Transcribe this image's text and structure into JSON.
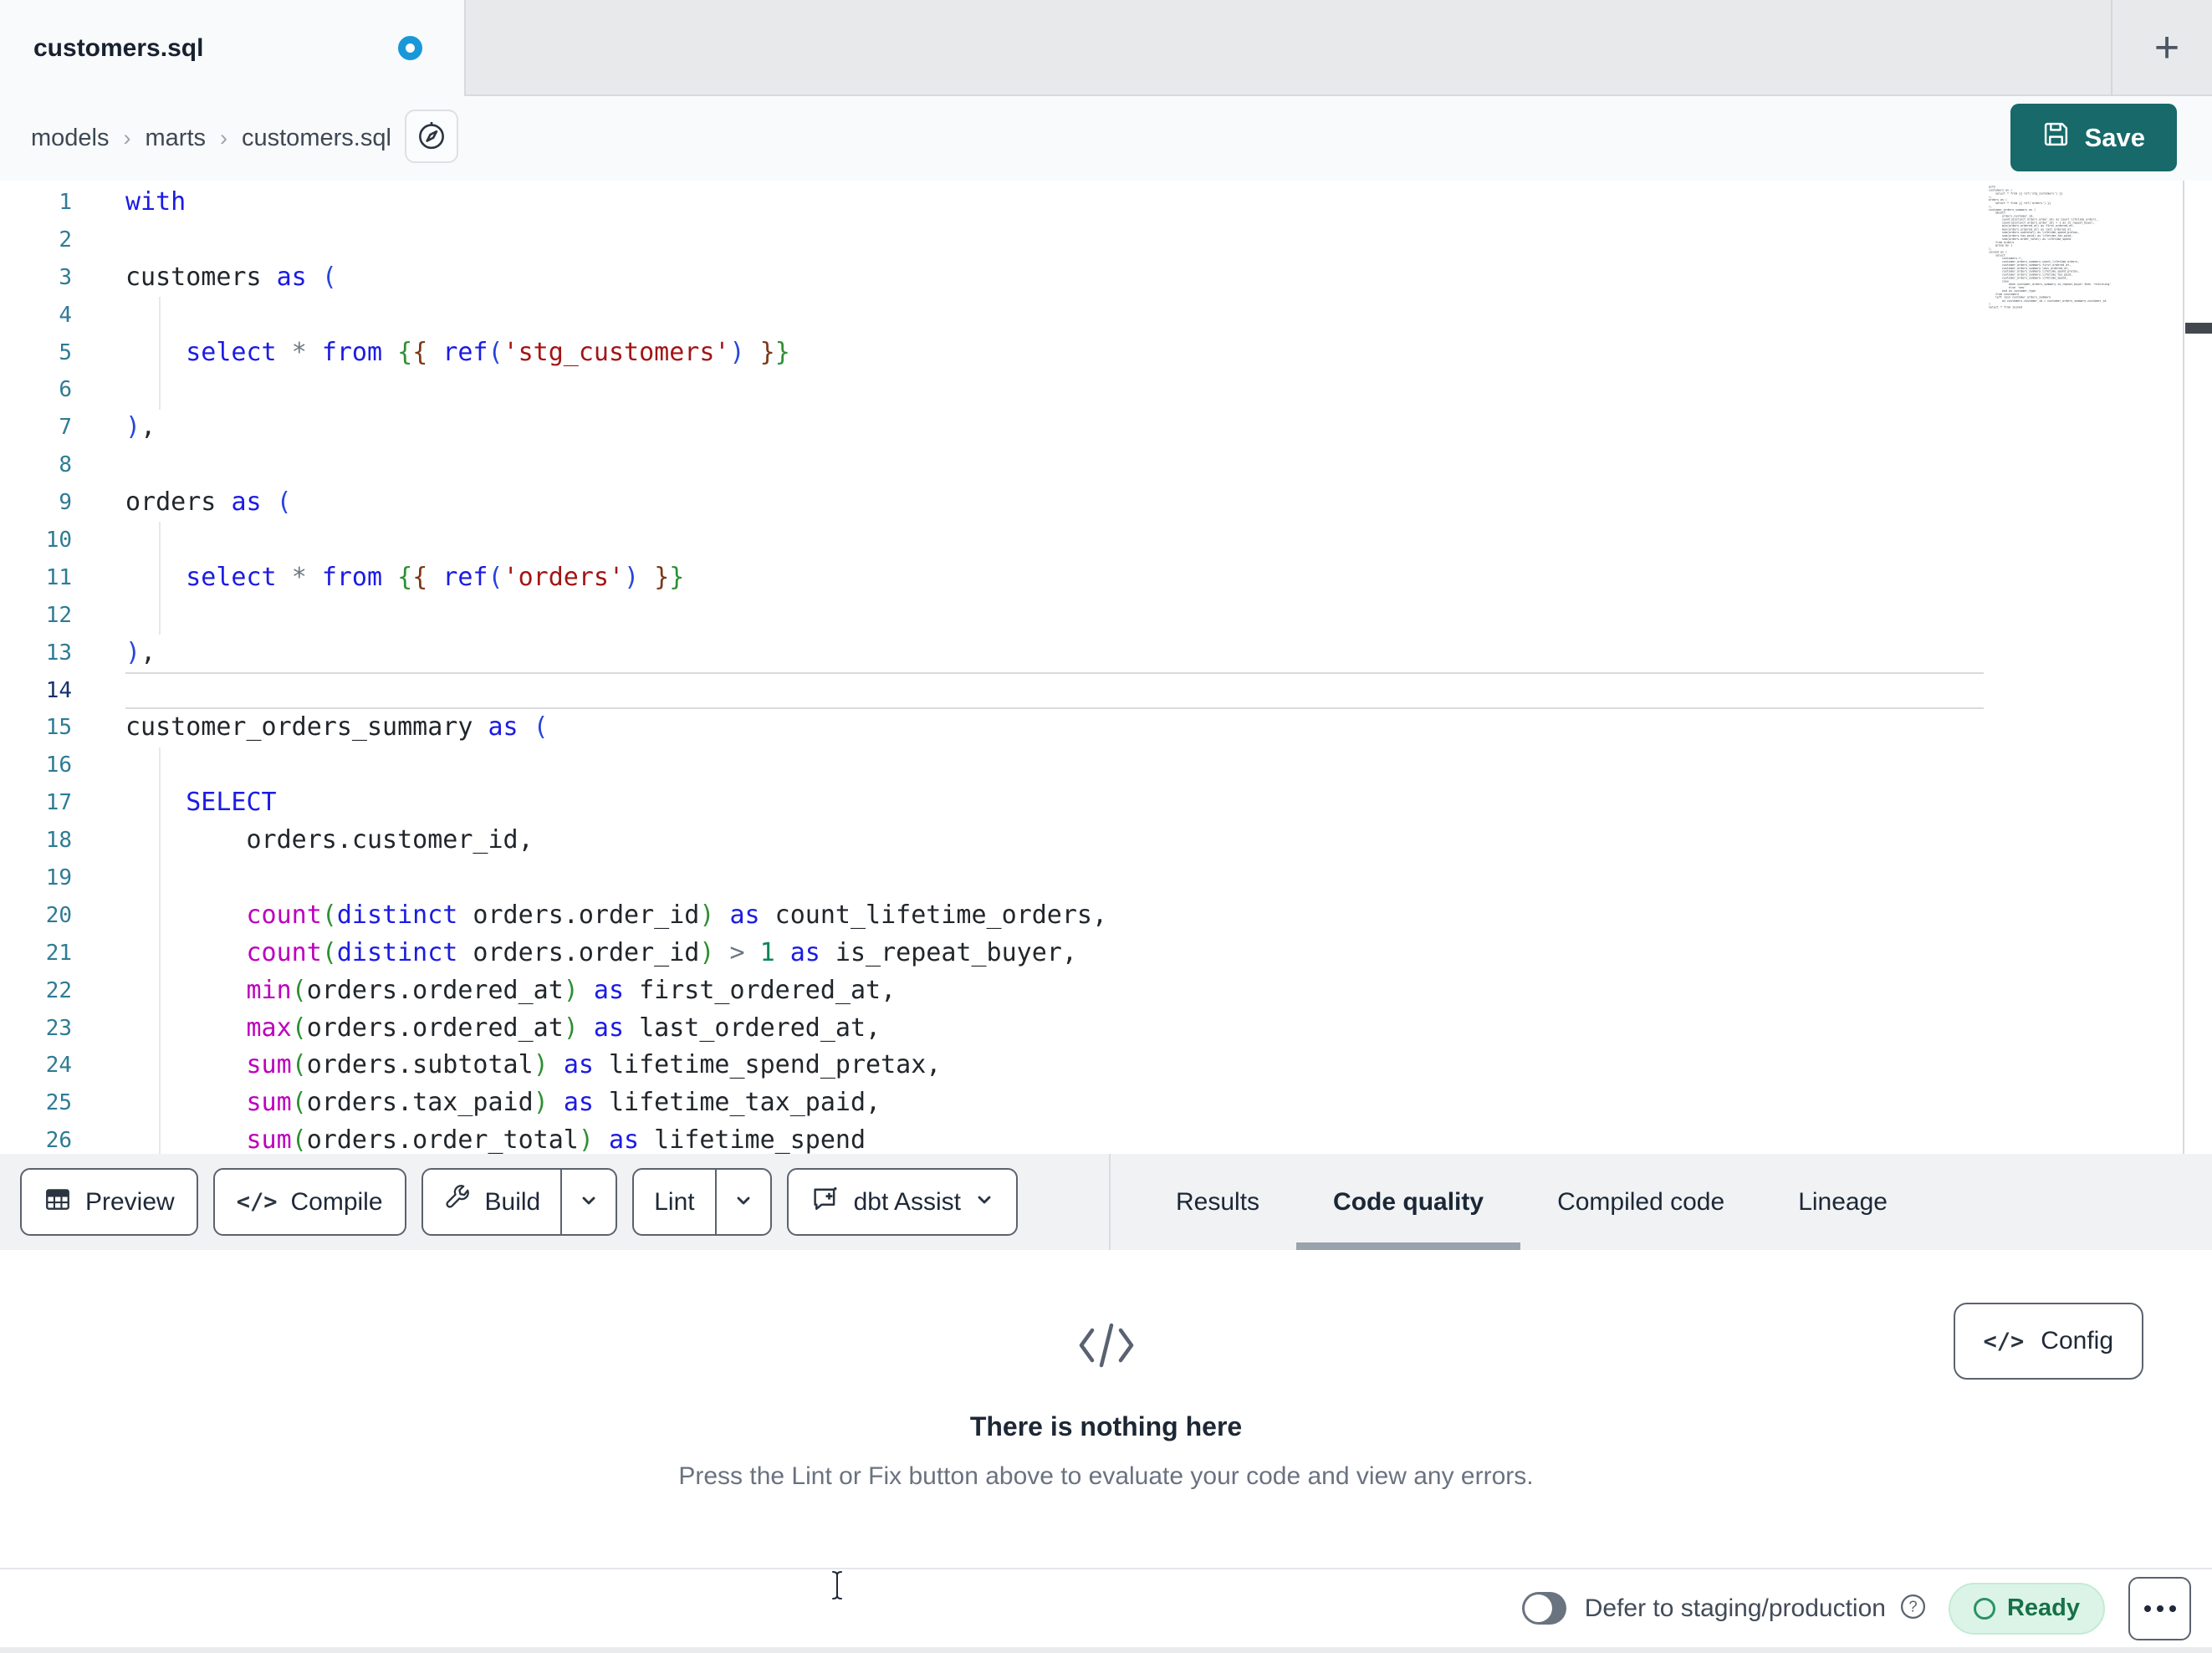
{
  "tab": {
    "title": "customers.sql",
    "new_tab_label": "+"
  },
  "breadcrumb": {
    "items": [
      "models",
      "marts",
      "customers.sql"
    ],
    "separator": "›"
  },
  "save": {
    "label": "Save"
  },
  "colors": {
    "accent_teal": "#17696a",
    "unsaved_dot_blue": "#1898d8",
    "ready_bg": "#dcf4e7",
    "ready_text": "#177148"
  },
  "editor": {
    "active_line": 14,
    "lines": [
      {
        "n": 1,
        "tokens": [
          [
            "kw",
            "with"
          ]
        ]
      },
      {
        "n": 2,
        "tokens": []
      },
      {
        "n": 3,
        "tokens": [
          [
            "pl",
            "customers "
          ],
          [
            "kw",
            "as"
          ],
          [
            "pl",
            " "
          ],
          [
            "b",
            "("
          ]
        ]
      },
      {
        "n": 4,
        "tokens": []
      },
      {
        "n": 5,
        "tokens": [
          [
            "pl",
            "    "
          ],
          [
            "kw",
            "select"
          ],
          [
            "pl",
            " "
          ],
          [
            "op",
            "*"
          ],
          [
            "pl",
            " "
          ],
          [
            "kw",
            "from"
          ],
          [
            "pl",
            " "
          ],
          [
            "g",
            "{"
          ],
          [
            "br",
            "{"
          ],
          [
            "pl",
            " "
          ],
          [
            "kw",
            "ref"
          ],
          [
            "b",
            "("
          ],
          [
            "str",
            "'stg_customers'"
          ],
          [
            "b",
            ")"
          ],
          [
            "pl",
            " "
          ],
          [
            "br",
            "}"
          ],
          [
            "g",
            "}"
          ]
        ]
      },
      {
        "n": 6,
        "tokens": []
      },
      {
        "n": 7,
        "tokens": [
          [
            "b",
            ")"
          ],
          [
            "pl",
            ","
          ]
        ]
      },
      {
        "n": 8,
        "tokens": []
      },
      {
        "n": 9,
        "tokens": [
          [
            "pl",
            "orders "
          ],
          [
            "kw",
            "as"
          ],
          [
            "pl",
            " "
          ],
          [
            "b",
            "("
          ]
        ]
      },
      {
        "n": 10,
        "tokens": []
      },
      {
        "n": 11,
        "tokens": [
          [
            "pl",
            "    "
          ],
          [
            "kw",
            "select"
          ],
          [
            "pl",
            " "
          ],
          [
            "op",
            "*"
          ],
          [
            "pl",
            " "
          ],
          [
            "kw",
            "from"
          ],
          [
            "pl",
            " "
          ],
          [
            "g",
            "{"
          ],
          [
            "br",
            "{"
          ],
          [
            "pl",
            " "
          ],
          [
            "kw",
            "ref"
          ],
          [
            "b",
            "("
          ],
          [
            "str",
            "'orders'"
          ],
          [
            "b",
            ")"
          ],
          [
            "pl",
            " "
          ],
          [
            "br",
            "}"
          ],
          [
            "g",
            "}"
          ]
        ]
      },
      {
        "n": 12,
        "tokens": []
      },
      {
        "n": 13,
        "tokens": [
          [
            "b",
            ")"
          ],
          [
            "pl",
            ","
          ]
        ]
      },
      {
        "n": 14,
        "tokens": []
      },
      {
        "n": 15,
        "tokens": [
          [
            "pl",
            "customer_orders_summary "
          ],
          [
            "kw",
            "as"
          ],
          [
            "pl",
            " "
          ],
          [
            "b",
            "("
          ]
        ]
      },
      {
        "n": 16,
        "tokens": []
      },
      {
        "n": 17,
        "tokens": [
          [
            "pl",
            "    "
          ],
          [
            "kw",
            "SELECT"
          ]
        ]
      },
      {
        "n": 18,
        "tokens": [
          [
            "pl",
            "        orders.customer_id,"
          ]
        ]
      },
      {
        "n": 19,
        "tokens": []
      },
      {
        "n": 20,
        "tokens": [
          [
            "pl",
            "        "
          ],
          [
            "fn",
            "count"
          ],
          [
            "g",
            "("
          ],
          [
            "kw",
            "distinct"
          ],
          [
            "pl",
            " orders.order_id"
          ],
          [
            "g",
            ")"
          ],
          [
            "pl",
            " "
          ],
          [
            "kw",
            "as"
          ],
          [
            "pl",
            " count_lifetime_orders,"
          ]
        ]
      },
      {
        "n": 21,
        "tokens": [
          [
            "pl",
            "        "
          ],
          [
            "fn",
            "count"
          ],
          [
            "g",
            "("
          ],
          [
            "kw",
            "distinct"
          ],
          [
            "pl",
            " orders.order_id"
          ],
          [
            "g",
            ")"
          ],
          [
            "pl",
            " "
          ],
          [
            "op",
            ">"
          ],
          [
            "pl",
            " "
          ],
          [
            "num",
            "1"
          ],
          [
            "pl",
            " "
          ],
          [
            "kw",
            "as"
          ],
          [
            "pl",
            " is_repeat_buyer,"
          ]
        ]
      },
      {
        "n": 22,
        "tokens": [
          [
            "pl",
            "        "
          ],
          [
            "fn",
            "min"
          ],
          [
            "g",
            "("
          ],
          [
            "pl",
            "orders.ordered_at"
          ],
          [
            "g",
            ")"
          ],
          [
            "pl",
            " "
          ],
          [
            "kw",
            "as"
          ],
          [
            "pl",
            " first_ordered_at,"
          ]
        ]
      },
      {
        "n": 23,
        "tokens": [
          [
            "pl",
            "        "
          ],
          [
            "fn",
            "max"
          ],
          [
            "g",
            "("
          ],
          [
            "pl",
            "orders.ordered_at"
          ],
          [
            "g",
            ")"
          ],
          [
            "pl",
            " "
          ],
          [
            "kw",
            "as"
          ],
          [
            "pl",
            " last_ordered_at,"
          ]
        ]
      },
      {
        "n": 24,
        "tokens": [
          [
            "pl",
            "        "
          ],
          [
            "fn",
            "sum"
          ],
          [
            "g",
            "("
          ],
          [
            "pl",
            "orders.subtotal"
          ],
          [
            "g",
            ")"
          ],
          [
            "pl",
            " "
          ],
          [
            "kw",
            "as"
          ],
          [
            "pl",
            " lifetime_spend_pretax,"
          ]
        ]
      },
      {
        "n": 25,
        "tokens": [
          [
            "pl",
            "        "
          ],
          [
            "fn",
            "sum"
          ],
          [
            "g",
            "("
          ],
          [
            "pl",
            "orders.tax_paid"
          ],
          [
            "g",
            ")"
          ],
          [
            "pl",
            " "
          ],
          [
            "kw",
            "as"
          ],
          [
            "pl",
            " lifetime_tax_paid,"
          ]
        ]
      },
      {
        "n": 26,
        "tokens": [
          [
            "pl",
            "        "
          ],
          [
            "fn",
            "sum"
          ],
          [
            "g",
            "("
          ],
          [
            "pl",
            "orders.order_total"
          ],
          [
            "g",
            ")"
          ],
          [
            "pl",
            " "
          ],
          [
            "kw",
            "as"
          ],
          [
            "pl",
            " lifetime_spend"
          ]
        ]
      }
    ],
    "minimap_lines": [
      "with",
      "",
      "customers as (",
      "",
      "    select * from {{ ref('stg_customers') }}",
      "",
      "),",
      "",
      "orders as (",
      "",
      "    select * from {{ ref('orders') }}",
      "",
      "),",
      "",
      "customer_orders_summary as (",
      "",
      "    SELECT",
      "        orders.customer_id,",
      "",
      "        count(distinct orders.order_id) as count_lifetime_orders,",
      "        count(distinct orders.order_id) > 1 as is_repeat_buyer,",
      "        min(orders.ordered_at) as first_ordered_at,",
      "        max(orders.ordered_at) as last_ordered_at,",
      "        sum(orders.subtotal) as lifetime_spend_pretax,",
      "        sum(orders.tax_paid) as lifetime_tax_paid,",
      "        sum(orders.order_total) as lifetime_spend",
      "",
      "    from orders",
      "",
      "    group by 1",
      "",
      "),",
      "",
      "joined as (",
      "",
      "    select",
      "        customers.*,",
      "",
      "        customer_orders_summary.count_lifetime_orders,",
      "        customer_orders_summary.first_ordered_at,",
      "        customer_orders_summary.last_ordered_at,",
      "        customer_orders_summary.lifetime_spend_pretax,",
      "        customer_orders_summary.lifetime_tax_paid,",
      "        customer_orders_summary.lifetime_spend,",
      "",
      "        case",
      "            when customer_orders_summary.is_repeat_buyer then 'returning'",
      "            else 'new'",
      "        end as customer_type",
      "",
      "    from customers",
      "",
      "    left join customer_orders_summary",
      "        on customers.customer_id = customer_orders_summary.customer_id",
      "",
      ")",
      "",
      "select * from joined"
    ]
  },
  "toolbar": {
    "preview_label": "Preview",
    "compile_label": "Compile",
    "build_label": "Build",
    "lint_label": "Lint",
    "assist_label": "dbt Assist",
    "compile_glyph": "</>"
  },
  "panel_tabs": {
    "items": [
      "Results",
      "Code quality",
      "Compiled code",
      "Lineage"
    ],
    "active": "Code quality"
  },
  "empty_state": {
    "title": "There is nothing here",
    "subtitle": "Press the Lint or Fix button above to evaluate your code and view any errors."
  },
  "config": {
    "label": "Config",
    "glyph": "</>"
  },
  "statusbar": {
    "defer_label": "Defer to staging/production",
    "ready_label": "Ready"
  }
}
